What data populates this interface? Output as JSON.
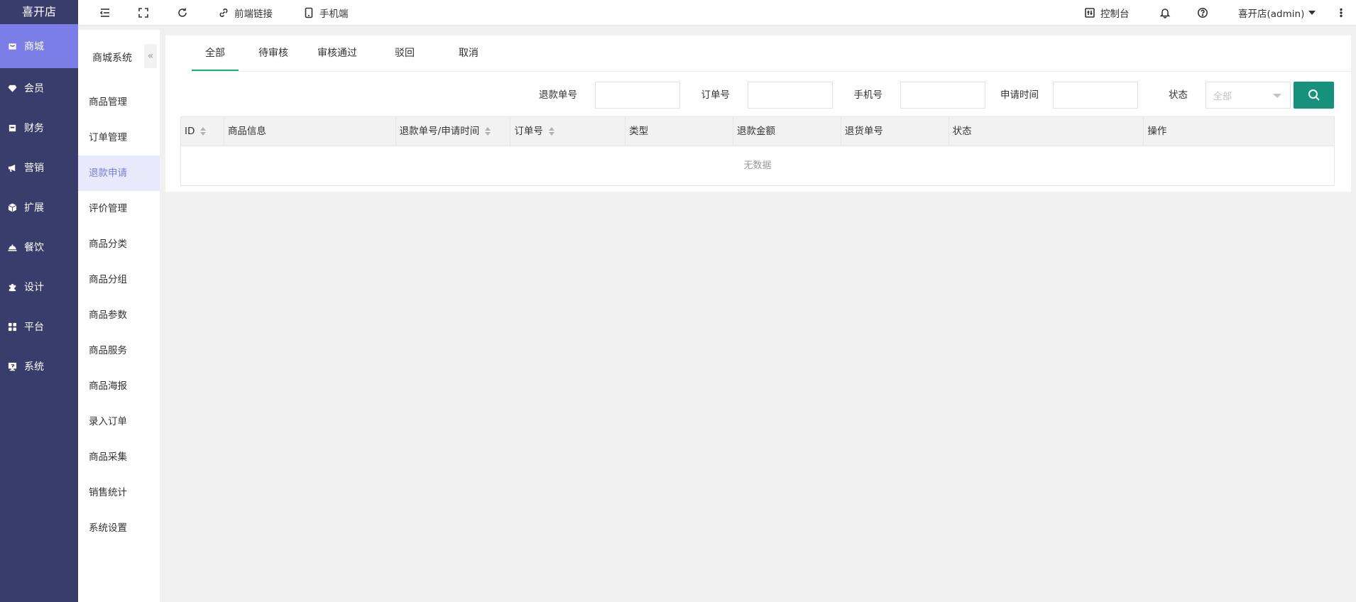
{
  "brand": "喜开店",
  "main_nav": [
    {
      "label": "商城",
      "icon": "shop-bag-icon",
      "active": true
    },
    {
      "label": "会员",
      "icon": "member-gem-icon"
    },
    {
      "label": "财务",
      "icon": "finance-icon"
    },
    {
      "label": "营销",
      "icon": "megaphone-icon"
    },
    {
      "label": "扩展",
      "icon": "cube-icon"
    },
    {
      "label": "餐饮",
      "icon": "dining-cloche-icon"
    },
    {
      "label": "设计",
      "icon": "puzzle-icon"
    },
    {
      "label": "平台",
      "icon": "grid-apps-icon"
    },
    {
      "label": "系统",
      "icon": "system-monitor-icon"
    }
  ],
  "sub_nav": {
    "title": "商城系统",
    "collapse_glyph": "«",
    "items": [
      "商品管理",
      "订单管理",
      "退款申请",
      "评价管理",
      "商品分类",
      "商品分组",
      "商品参数",
      "商品服务",
      "商品海报",
      "录入订单",
      "商品采集",
      "销售统计",
      "系统设置"
    ],
    "active_index": 2
  },
  "topbar": {
    "front_link_label": "前端链接",
    "mobile_label": "手机端",
    "console_label": "控制台",
    "user_label": "喜开店(admin)"
  },
  "tabs": [
    "全部",
    "待审核",
    "审核通过",
    "驳回",
    "取消"
  ],
  "active_tab": 0,
  "filters": {
    "refund_no_label": "退款单号",
    "order_no_label": "订单号",
    "phone_label": "手机号",
    "apply_time_label": "申请时间",
    "status_label": "状态",
    "status_value": "全部"
  },
  "table": {
    "columns": [
      {
        "label": "ID",
        "sortable": true
      },
      {
        "label": "商品信息",
        "sortable": false
      },
      {
        "label": "退款单号/申请时间",
        "sortable": true
      },
      {
        "label": "订单号",
        "sortable": true
      },
      {
        "label": "类型",
        "sortable": false
      },
      {
        "label": "退款金额",
        "sortable": false
      },
      {
        "label": "退货单号",
        "sortable": false
      },
      {
        "label": "状态",
        "sortable": false
      },
      {
        "label": "操作",
        "sortable": false
      }
    ],
    "empty_text": "无数据"
  },
  "colors": {
    "main_nav_bg": "#393d6b",
    "accent": "#7a7ee6",
    "tab_underline": "#16b56b",
    "search_button": "#16917c"
  }
}
